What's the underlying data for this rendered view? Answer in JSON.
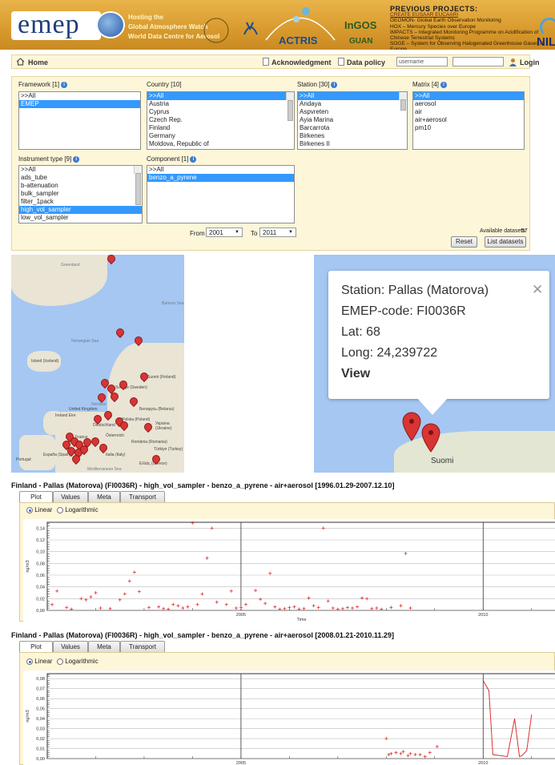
{
  "header": {
    "logo": "emep",
    "hosting": [
      "Hosting the",
      "Global Atmosphere Watch",
      "World Data Centre for Aerosol"
    ],
    "partner_logos": [
      "ACTRIS",
      "InGOS",
      "GUAN",
      "NILU"
    ],
    "previous_projects": {
      "title": "PREVIOUS PROJECTS:",
      "link": "CREATE EUSAAR EUCAARI",
      "lines": [
        "GEOMON- Global Earth Observation Monitoring",
        "HOX – Mercury Species over Europe",
        "IMPACTS – Integrated Monitoring Programme on Acidification of",
        "Chinese Terrestrial Systems",
        "SOGE – System for Observing Halogenated Greenhouse Gases in Europe"
      ]
    }
  },
  "toolbar": {
    "home": "Home",
    "acknowledgment": "Acknowledgment",
    "data_policy": "Data policy",
    "username_placeholder": "username",
    "login": "Login"
  },
  "filters": {
    "framework": {
      "label": "Framework [1]",
      "items": [
        ">>All",
        "EMEP"
      ],
      "selected": "EMEP"
    },
    "country": {
      "label": "Country [10]",
      "items": [
        ">>All",
        "Austria",
        "Cyprus",
        "Czech Rep.",
        "Finland",
        "Germany",
        "Moldova, Republic of"
      ],
      "selected": ">>All"
    },
    "station": {
      "label": "Station [30]",
      "items": [
        ">>All",
        "Andaya",
        "Aspvreten",
        "Ayia Marina",
        "Barcarrota",
        "Birkenes",
        "Birkenes II"
      ],
      "selected": ">>All"
    },
    "matrix": {
      "label": "Matrix [4]",
      "items": [
        ">>All",
        "aerosol",
        "air",
        "air+aerosol",
        "pm10"
      ],
      "selected": ">>All"
    },
    "instrument": {
      "label": "Instrument type [9]",
      "items": [
        ">>All",
        "ads_tube",
        "b-attenuation",
        "bulk_sampler",
        "filter_1pack",
        "high_vol_sampler",
        "low_vol_sampler"
      ],
      "selected": "high_vol_sampler"
    },
    "component": {
      "label": "Component [1]",
      "items": [
        ">>All",
        "benzo_a_pyrene"
      ],
      "selected": "benzo_a_pyrene"
    },
    "from_label": "From",
    "from_value": "2001",
    "to_label": "To",
    "to_value": "2011",
    "available_label": "Available datasets:",
    "available_count": "57",
    "reset": "Reset",
    "list": "List datasets"
  },
  "map": {
    "labels": [
      "Greenland",
      "Barents Sea",
      "Norwegian Sea",
      "Island (Iceland)",
      "Sverige (Sweden)",
      "Suomi (Finland)",
      "United Kingdom",
      "Ireland Eire",
      "Nordsee",
      "Polska (Poland)",
      "Deutschland",
      "Беларусь (Belarus)",
      "Україна (Ukraine)",
      "France",
      "Österreich",
      "România (Romania)",
      "Italia (Italy)",
      "España (Spain)",
      "Portugal",
      "Ελλάς (Greece)",
      "Türkiye (Turkey)",
      "Mediterranean Sea"
    ],
    "popup": {
      "station": "Station: Pallas (Matorova)",
      "code": "EMEP-code: FI0036R",
      "lat": "Lat: 68",
      "long": "Long: 24,239722",
      "view": "View",
      "close": "✕"
    },
    "zoom_label": "Suomi"
  },
  "plot1": {
    "title": "Finland - Pallas (Matorova) (FI0036R) - high_vol_sampler - benzo_a_pyrene - air+aerosol [1996.01.29-2007.12.10]",
    "tabs": [
      "Plot",
      "Values",
      "Meta",
      "Transport"
    ],
    "scale_options": [
      "Linear",
      "Logarithmic"
    ],
    "selected_scale": "Linear"
  },
  "plot2": {
    "title": "Finland - Pallas (Matorova) (FI0036R) - high_vol_sampler - benzo_a_pyrene - air+aerosol [2008.01.21-2010.11.29]",
    "tabs": [
      "Plot",
      "Values",
      "Meta",
      "Transport"
    ],
    "scale_options": [
      "Linear",
      "Logarithmic"
    ],
    "selected_scale": "Linear"
  },
  "chart_data": [
    {
      "type": "scatter",
      "ylabel": "ng/m3",
      "xlabel": "Time",
      "xlim": [
        2001.0,
        2011.5
      ],
      "ylim": [
        0,
        0.15
      ],
      "xticks": [
        "2005",
        "2010"
      ],
      "yticks": [
        "0,00",
        "0,02",
        "0,04",
        "0,06",
        "0,08",
        "0,10",
        "0,12",
        "0,14"
      ],
      "color": "#e03030",
      "points": [
        [
          2001.1,
          0.01
        ],
        [
          2001.2,
          0.033
        ],
        [
          2001.4,
          0.005
        ],
        [
          2001.5,
          0.002
        ],
        [
          2001.7,
          0.02
        ],
        [
          2001.8,
          0.018
        ],
        [
          2001.9,
          0.023
        ],
        [
          2002.0,
          0.03
        ],
        [
          2002.1,
          0.004
        ],
        [
          2002.3,
          0.003
        ],
        [
          2002.5,
          0.018
        ],
        [
          2002.6,
          0.028
        ],
        [
          2002.7,
          0.05
        ],
        [
          2002.8,
          0.065
        ],
        [
          2002.9,
          0.032
        ],
        [
          2003.1,
          0.005
        ],
        [
          2003.3,
          0.006
        ],
        [
          2003.4,
          0.003
        ],
        [
          2003.5,
          0.002
        ],
        [
          2003.6,
          0.01
        ],
        [
          2003.7,
          0.008
        ],
        [
          2003.8,
          0.004
        ],
        [
          2003.9,
          0.006
        ],
        [
          2004.0,
          0.149
        ],
        [
          2004.1,
          0.01
        ],
        [
          2004.2,
          0.028
        ],
        [
          2004.3,
          0.089
        ],
        [
          2004.4,
          0.14
        ],
        [
          2004.5,
          0.014
        ],
        [
          2004.7,
          0.01
        ],
        [
          2004.8,
          0.033
        ],
        [
          2004.9,
          0.004
        ],
        [
          2005.0,
          0.005
        ],
        [
          2005.1,
          0.01
        ],
        [
          2005.3,
          0.034
        ],
        [
          2005.4,
          0.019
        ],
        [
          2005.5,
          0.012
        ],
        [
          2005.6,
          0.063
        ],
        [
          2005.7,
          0.006
        ],
        [
          2005.8,
          0.002
        ],
        [
          2005.9,
          0.003
        ],
        [
          2006.0,
          0.005
        ],
        [
          2006.1,
          0.006
        ],
        [
          2006.2,
          0.002
        ],
        [
          2006.3,
          0.003
        ],
        [
          2006.4,
          0.021
        ],
        [
          2006.5,
          0.008
        ],
        [
          2006.6,
          0.005
        ],
        [
          2006.7,
          0.14
        ],
        [
          2006.8,
          0.016
        ],
        [
          2006.9,
          0.004
        ],
        [
          2007.0,
          0.002
        ],
        [
          2007.1,
          0.003
        ],
        [
          2007.2,
          0.005
        ],
        [
          2007.3,
          0.004
        ],
        [
          2007.4,
          0.006
        ],
        [
          2007.5,
          0.021
        ],
        [
          2007.6,
          0.02
        ],
        [
          2007.7,
          0.003
        ],
        [
          2007.8,
          0.004
        ],
        [
          2007.9,
          0.002
        ],
        [
          2008.1,
          0.005
        ],
        [
          2008.3,
          0.008
        ],
        [
          2008.4,
          0.097
        ],
        [
          2008.5,
          0.004
        ]
      ]
    },
    {
      "type": "line",
      "ylabel": "ng/m3",
      "xlim": [
        2001.0,
        2011.5
      ],
      "ylim": [
        0,
        0.085
      ],
      "xticks": [
        "2005",
        "2010"
      ],
      "yticks": [
        "0,00",
        "0,01",
        "0,02",
        "0,03",
        "0,04",
        "0,05",
        "0,06",
        "0,07",
        "0,08"
      ],
      "color": "#e03030",
      "points": [
        [
          2008.0,
          0.02
        ],
        [
          2008.05,
          0.004
        ],
        [
          2008.1,
          0.005
        ],
        [
          2008.2,
          0.006
        ],
        [
          2008.3,
          0.005
        ],
        [
          2008.35,
          0.007
        ],
        [
          2008.45,
          0.003
        ],
        [
          2008.5,
          0.005
        ],
        [
          2008.6,
          0.004
        ],
        [
          2008.7,
          0.004
        ],
        [
          2008.8,
          0.002
        ],
        [
          2008.9,
          0.006
        ],
        [
          2009.05,
          0.012
        ]
      ],
      "line": [
        [
          2010.0,
          0.078
        ],
        [
          2010.12,
          0.068
        ],
        [
          2010.2,
          0.004
        ],
        [
          2010.5,
          0.002
        ],
        [
          2010.65,
          0.04
        ],
        [
          2010.75,
          0.002
        ],
        [
          2010.8,
          0.003
        ],
        [
          2010.9,
          0.008
        ],
        [
          2011.0,
          0.044
        ]
      ]
    }
  ]
}
